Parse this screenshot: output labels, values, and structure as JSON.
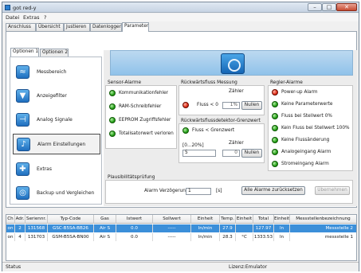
{
  "window": {
    "title": "got red-y",
    "min": "–",
    "max": "□",
    "close": "✕"
  },
  "menu": [
    "Datei",
    "Extras",
    "?"
  ],
  "tabs": [
    "Anschluss",
    "Übersicht",
    "Justieren",
    "Datenlogger",
    "Parameter"
  ],
  "subtabs": [
    "Optionen 1",
    "Optionen 2"
  ],
  "nav": [
    {
      "label": "Messbereich",
      "icon": "ruler-icon",
      "glyph": "≈"
    },
    {
      "label": "Anzeigefilter",
      "icon": "filter-icon",
      "glyph": "▼"
    },
    {
      "label": "Analog Signale",
      "icon": "analog-signal-icon",
      "glyph": "⊣"
    },
    {
      "label": "Alarm Einstellungen",
      "icon": "alarm-bell-icon",
      "glyph": "♪"
    },
    {
      "label": "Extras",
      "icon": "extras-icon",
      "glyph": "✚"
    },
    {
      "label": "Backup und Vergleichen",
      "icon": "backup-icon",
      "glyph": "◎"
    }
  ],
  "sensor": {
    "title": "Sensor-Alarme",
    "items": [
      "Kommunikationfehler",
      "RAM-Schreibfehler",
      "EEPROM Zugriffsfehler",
      "Totalisatorwert verloren"
    ]
  },
  "backflow": {
    "title": "Rückwärtsfluss Messung",
    "counter_label": "Zähler",
    "label": "Fluss < 0",
    "value": "1%",
    "reset": "Nullen"
  },
  "backflow_detect": {
    "title": "Rückwärtsflussdetektor-Grenzwert",
    "label": "Fluss < Grenzwert",
    "range_label": "[0...20%]",
    "value": "5",
    "counter_label": "Zähler",
    "counter": "0",
    "reset": "Nullen"
  },
  "regler": {
    "title": "Regler-Alarme",
    "items": [
      {
        "label": "Power-up Alarm",
        "status": "red"
      },
      {
        "label": "Keine Parameterwerte",
        "status": "green"
      },
      {
        "label": "Fluss bei Stellwert 0%",
        "status": "green"
      },
      {
        "label": "Kein Fluss bei Stellwert 100%",
        "status": "green"
      },
      {
        "label": "Keine Flussänderung",
        "status": "green"
      },
      {
        "label": "Analogeingang Alarm",
        "status": "green"
      },
      {
        "label": "Stromeingang Alarm",
        "status": "green"
      }
    ]
  },
  "plaus": {
    "title": "Plausibilitätsprüfung",
    "delay_label": "Alarm Verzögerung",
    "delay_value": "1",
    "unit": "[s]",
    "reset_all": "Alle Alarme zurücksetzen",
    "apply": "Übernehmen"
  },
  "table": {
    "headers": [
      "Ch",
      "Adr.",
      "Seriennr.",
      "Typ-Code",
      "Gas",
      "Istwert",
      "Sollwert",
      "Einheit",
      "Temp.",
      "Einheit",
      "Total",
      "Einheit",
      "Messstellenbezeichnung"
    ],
    "rows": [
      [
        "on",
        "2",
        "131568",
        "GSC-B5SA-BB26",
        "Air S",
        "0.0",
        "-----",
        "ln/min",
        "27.9",
        "",
        "127.97",
        "ln",
        "Messstelle 2"
      ],
      [
        "on",
        "4",
        "131703",
        "GSM-B5SA-BN00",
        "Air S",
        "0.0",
        "-----",
        "ln/min",
        "28.3",
        "°C",
        "1333.53",
        "ln",
        "messstelle 1"
      ]
    ]
  },
  "status": {
    "left": "Status",
    "license": "Lizenz:Emulator"
  }
}
